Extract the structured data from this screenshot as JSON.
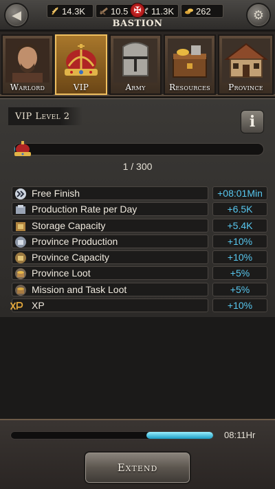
{
  "topbar": {
    "location": "BASTION",
    "resources": {
      "wheat": "14.3K",
      "wood": "10.5",
      "stone": "11.3K",
      "gold": "262"
    }
  },
  "tabs": [
    {
      "label": "Warlord",
      "icon": "warlord-portrait"
    },
    {
      "label": "VIP",
      "icon": "crown-icon",
      "active": true
    },
    {
      "label": "Army",
      "icon": "helmet-icon"
    },
    {
      "label": "Resources",
      "icon": "chest-icon"
    },
    {
      "label": "Province",
      "icon": "house-icon"
    }
  ],
  "vip": {
    "level_label": "VIP Level 2",
    "progress_text": "1 / 300",
    "progress_fraction": 0.0033
  },
  "bonuses": [
    {
      "name": "Free Finish",
      "value": "+08:01Min",
      "icon": "fast-forward-icon"
    },
    {
      "name": "Production Rate per Day",
      "value": "+6.5K",
      "icon": "production-icon"
    },
    {
      "name": "Storage Capacity",
      "value": "+5.4K",
      "icon": "storage-icon"
    },
    {
      "name": "Province Production",
      "value": "+10%",
      "icon": "province-production-icon"
    },
    {
      "name": "Province Capacity",
      "value": "+10%",
      "icon": "province-capacity-icon"
    },
    {
      "name": "Province Loot",
      "value": "+5%",
      "icon": "loot-icon"
    },
    {
      "name": "Mission and Task Loot",
      "value": "+5%",
      "icon": "mission-loot-icon"
    },
    {
      "name": "XP",
      "value": "+10%",
      "icon": "xp-icon"
    }
  ],
  "footer": {
    "timer_text": "08:11Hr",
    "timer_fraction": 0.33,
    "extend_label": "Extend"
  },
  "colors": {
    "accent_blue": "#58c8f0",
    "active_tab": "#a8772b"
  }
}
